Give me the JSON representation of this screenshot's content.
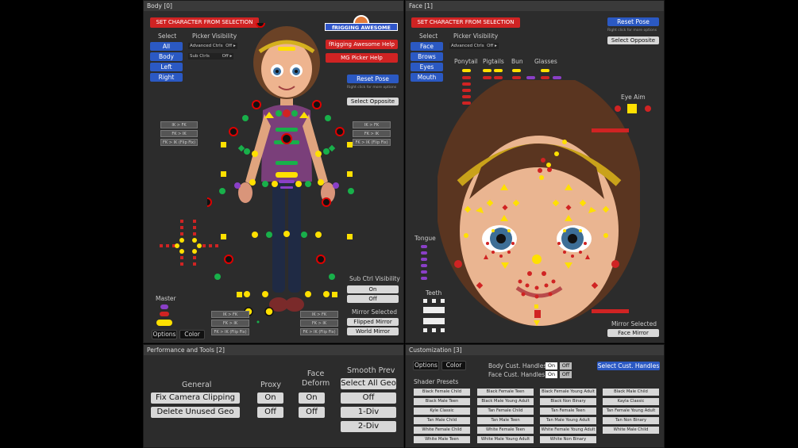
{
  "body_panel": {
    "title": "Body [0]",
    "set_char_btn": "SET CHARACTER FROM SELECTION",
    "select_label": "Select",
    "picker_vis_label": "Picker Visibility",
    "select_buttons": [
      "All",
      "Body",
      "Left",
      "Right"
    ],
    "adv_ctrls": "Advanced Ctrls",
    "sub_ctrls": "Sub Ctrls",
    "off_label": "Off",
    "logo_text": "fRIGGING AWESOME",
    "help_btn": "fRigging Awesome Help",
    "picker_help_btn": "MG Picker Help",
    "reset_pose": "Reset Pose",
    "right_click_note": "Right click for more options",
    "select_opposite": "Select Opposite",
    "ikfk_left": [
      "IK > FK",
      "FK > IK",
      "FK > IK (Flip Fix)"
    ],
    "ikfk_right": [
      "IK > FK",
      "FK > IK",
      "FK > IK (Flip Fix)"
    ],
    "ikfk_bottom_left": [
      "IK > FK",
      "FK > IK",
      "FK > IK (Flip Fix)"
    ],
    "ikfk_bottom_right": [
      "IK > FK",
      "FK > IK",
      "FK > IK (Flip Fix)"
    ],
    "master_label": "Master",
    "options_btn": "Options",
    "color_btn": "Color",
    "sub_ctrl_vis": "Sub Ctrl Visibility",
    "on_btn": "On",
    "off_btn": "Off",
    "mirror_selected": "Mirror Selected",
    "flipped_mirror": "Flipped Mirror",
    "world_mirror": "World Mirror"
  },
  "face_panel": {
    "title": "Face [1]",
    "set_char_btn": "SET CHARACTER FROM SELECTION",
    "select_label": "Select",
    "picker_vis_label": "Picker Visibility",
    "select_buttons": [
      "Face",
      "Brows",
      "Eyes",
      "Mouth"
    ],
    "adv_ctrls": "Advanced Ctrls",
    "off_label": "Off",
    "reset_pose": "Reset Pose",
    "right_click_note": "Right click for more options",
    "select_opposite": "Select Opposite",
    "ponytail": "Ponytail",
    "pigtails": "Pigtails",
    "bun": "Bun",
    "glasses": "Glasses",
    "eye_aim": "Eye Aim",
    "tongue": "Tongue",
    "teeth": "Teeth",
    "mirror_selected": "Mirror Selected",
    "face_mirror": "Face Mirror"
  },
  "perf_panel": {
    "title": "Performance and Tools [2]",
    "general": "General",
    "proxy": "Proxy",
    "face_deform": "Face\nDeform",
    "smooth_prev": "Smooth Prev",
    "fix_camera": "Fix Camera Clipping",
    "delete_unused": "Delete Unused Geo",
    "proxy_on": "On",
    "proxy_off": "Off",
    "deform_on": "On",
    "deform_off": "Off",
    "select_all_geo": "Select All Geo",
    "smooth_off": "Off",
    "one_div": "1-Div",
    "two_div": "2-Div"
  },
  "custom_panel": {
    "title": "Customization [3]",
    "options_btn": "Options",
    "color_btn": "Color",
    "body_handles": "Body Cust. Handles",
    "face_handles": "Face Cust. Handles",
    "on": "On",
    "off": "Off",
    "select_handles": "Select Cust. Handles",
    "shader_presets": "Shader Presets",
    "shaders": [
      "Black Female Child",
      "Black Female Teen",
      "Black Female Young Adult",
      "Black Male Child",
      "Black Male Teen",
      "Black Male Young Adult",
      "Black Non Binary",
      "Kayla Classic",
      "Kyle Classic",
      "Tan Female Child",
      "Tan Female Teen",
      "Tan Female Young Adult",
      "Tan Male Child",
      "Tan Male Teen",
      "Tan Male Young Adult",
      "Tan Non Binary",
      "White Female Child",
      "White Female Teen",
      "White Female Young Adult",
      "White Male Child",
      "White Male Teen",
      "White Male Young Adult",
      "White Non Binary"
    ]
  }
}
